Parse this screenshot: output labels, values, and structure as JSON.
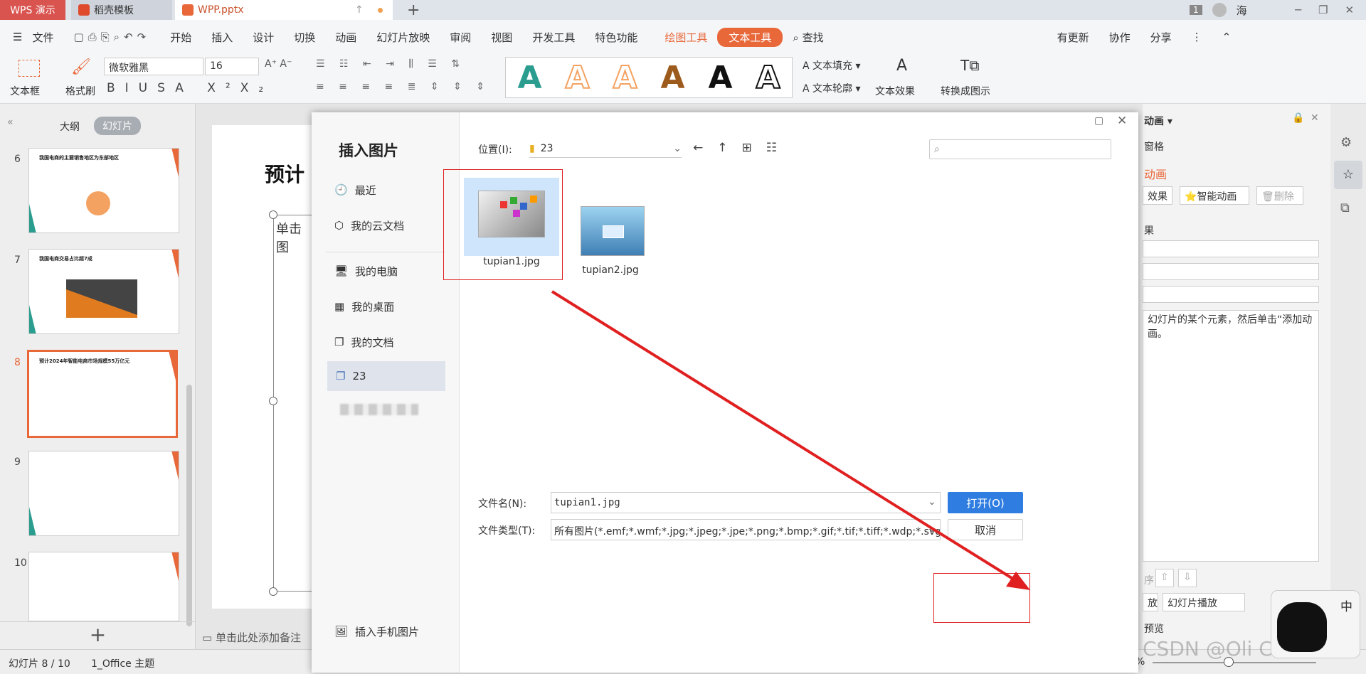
{
  "titlebar": {
    "app_tab": "WPS 演示",
    "docer_tab": "稻壳模板",
    "file_tab": "WPP.pptx",
    "window_badge": "1",
    "user_name": "海"
  },
  "menubar": {
    "file": "文件",
    "items": [
      "开始",
      "插入",
      "设计",
      "切换",
      "动画",
      "幻灯片放映",
      "审阅",
      "视图",
      "开发工具",
      "特色功能"
    ],
    "drawing_tools": "绘图工具",
    "text_tools": "文本工具",
    "search": "查找",
    "update": "有更新",
    "collab": "协作",
    "share": "分享"
  },
  "ribbon": {
    "textbox": "文本框",
    "format_painter": "格式刷",
    "font_name": "微软雅黑",
    "font_size": "16",
    "text_fill": "文本填充",
    "text_outline": "文本轮廓",
    "text_effect": "文本效果",
    "convert": "转换成图示"
  },
  "leftpane": {
    "outline_tab": "大纲",
    "slides_tab": "幻灯片",
    "slide_numbers": [
      "6",
      "7",
      "8",
      "9",
      "10"
    ],
    "thumb_titles": [
      "我国电商的主要销售地区为东部地区",
      "我国电商交易占比超7成",
      "预计2024年智能电商市场规模55万亿元"
    ]
  },
  "slide": {
    "title": "预计",
    "placeholder": "单击图",
    "notes": "单击此处添加备注"
  },
  "rightpane": {
    "heading": "动画",
    "pane_label": "窗格",
    "custom_anim": "动画",
    "effect_btn": "效果",
    "smart_anim": "智能动画",
    "delete_btn": "删除",
    "result_label": "果",
    "hint": "幻灯片的某个元素，然后单击“添加动画。",
    "play_btn": "放",
    "slideshow_btn": "幻灯片播放",
    "preview": "预览",
    "order_label": "序"
  },
  "status": {
    "slide_info": "幻灯片 8 / 10",
    "theme": "1_Office 主题",
    "zoom": "%"
  },
  "dialog": {
    "title": "插入图片",
    "nav_items": [
      "最近",
      "我的云文档",
      "我的电脑",
      "我的桌面",
      "我的文档",
      "23"
    ],
    "phone_image": "插入手机图片",
    "location_label": "位置(I):",
    "location_value": "23",
    "search_placeholder": "",
    "files": [
      {
        "name": "tupian1.jpg",
        "selected": true
      },
      {
        "name": "tupian2.jpg",
        "selected": false
      }
    ],
    "filename_label": "文件名(N):",
    "filename_value": "tupian1.jpg",
    "filetype_label": "文件类型(T):",
    "filetype_value": "所有图片(*.emf;*.wmf;*.jpg;*.jpeg;*.jpe;*.png;*.bmp;*.gif;*.tif;*.tiff;*.wdp;*.svg)",
    "open_btn": "打开(O)",
    "cancel_btn": "取消"
  },
  "watermark": "CSDN @Oli Correct",
  "ime": "中",
  "colors": {
    "accent_red": "#d9534f",
    "text_tools_orange": "#e8683a",
    "dialog_blue": "#2f7de1",
    "annotation_red": "#e02020"
  }
}
